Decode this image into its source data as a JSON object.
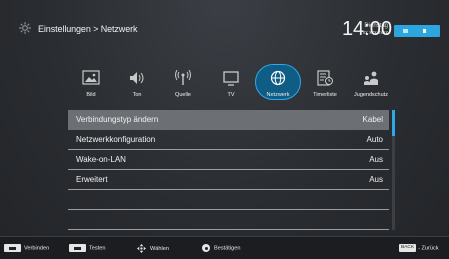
{
  "header": {
    "breadcrumb": "Einstellungen > Netzwerk",
    "day": "Dienstag",
    "date": "xx xxx xxxx",
    "time": "14:00",
    "accent": "#2ea8e6"
  },
  "tabs": [
    {
      "label": "Bild",
      "icon": "picture-icon"
    },
    {
      "label": "Ton",
      "icon": "speaker-icon"
    },
    {
      "label": "Quelle",
      "icon": "antenna-icon"
    },
    {
      "label": "TV",
      "icon": "tv-icon"
    },
    {
      "label": "Netzwerk",
      "icon": "network-globe-icon",
      "active": true
    },
    {
      "label": "Timerliste",
      "icon": "timer-list-icon"
    },
    {
      "label": "Jugendschutz",
      "icon": "parental-lock-icon"
    }
  ],
  "list": {
    "rows": [
      {
        "name": "Verbindungstyp ändern",
        "value": "Kabel",
        "selected": true
      },
      {
        "name": "Netzwerkkonfiguration",
        "value": "Auto"
      },
      {
        "name": "Wake-on-LAN",
        "value": "Aus"
      },
      {
        "name": "Erweitert",
        "value": "Aus"
      },
      {
        "name": "",
        "value": ""
      },
      {
        "name": "",
        "value": ""
      }
    ]
  },
  "footer": {
    "connect": "Verbinden",
    "test": "Testen",
    "select": "Wählen",
    "confirm": "Bestätigen",
    "back_key": "BACK",
    "back": "- Zurück"
  }
}
